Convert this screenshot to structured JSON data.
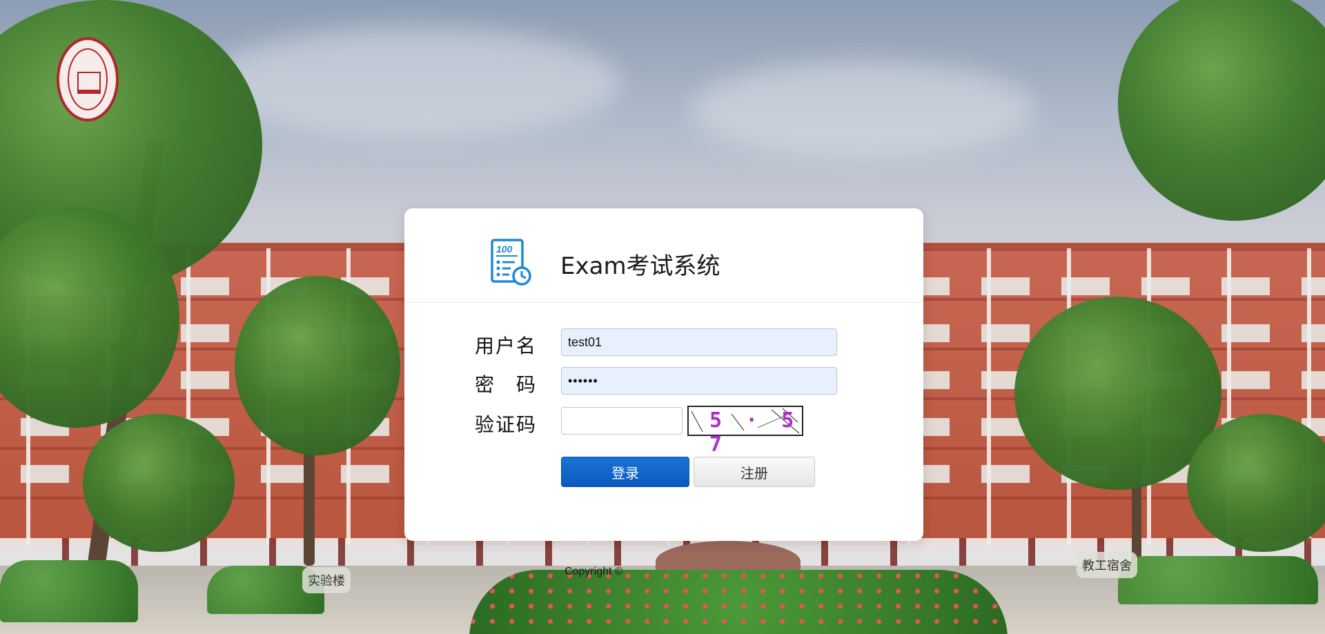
{
  "app": {
    "title": "Exam考试系统",
    "icon": "exam-score-clock-icon",
    "accent_color": "#1e88d6"
  },
  "login_form": {
    "username_label": "用户名",
    "username_value": "test01",
    "password_label": "密　码",
    "password_value": "••••••",
    "captcha_label": "验证码",
    "captcha_value": "",
    "captcha_text": "5 · 5 7",
    "login_button": "登录",
    "register_button": "注册",
    "login_button_color": "#0a5fc4"
  },
  "background": {
    "signs": [
      "实验楼",
      "教工宿舍"
    ]
  },
  "footer": {
    "copyright": "Copyright ©"
  }
}
